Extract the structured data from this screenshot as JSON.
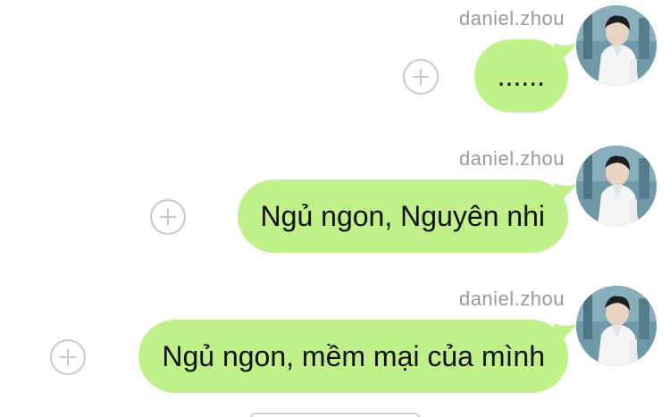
{
  "colors": {
    "bubble_bg": "#c0f08a",
    "username_text": "#9a9a9a",
    "add_button": "#c8c8c8"
  },
  "messages": [
    {
      "sender": "daniel.zhou",
      "text": "......",
      "avatar_icon": "user-avatar-icon"
    },
    {
      "sender": "daniel.zhou",
      "text": "Ngủ ngon, Nguyên nhi",
      "avatar_icon": "user-avatar-icon"
    },
    {
      "sender": "daniel.zhou",
      "text": "Ngủ ngon, mềm mại của mình",
      "avatar_icon": "user-avatar-icon"
    }
  ]
}
